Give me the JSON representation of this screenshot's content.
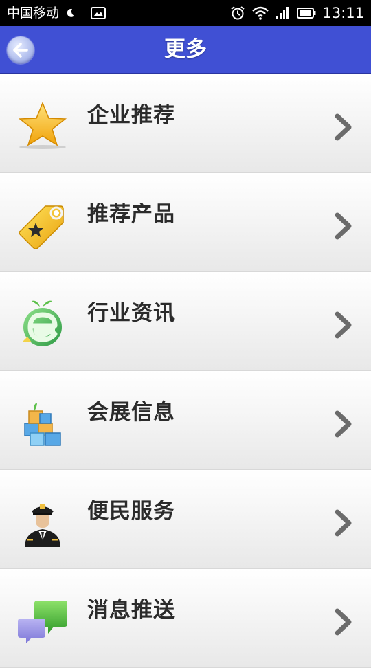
{
  "status_bar": {
    "carrier": "中国移动",
    "time": "13:11",
    "icons": [
      "moon-icon",
      "image-icon",
      "alarm-icon",
      "wifi-icon",
      "signal-icon",
      "battery-icon"
    ]
  },
  "header": {
    "title": "更多",
    "color": "#4050d4",
    "back_icon": "back-arrow-icon"
  },
  "menu": {
    "items": [
      {
        "label": "企业推荐",
        "icon": "star-icon"
      },
      {
        "label": "推荐产品",
        "icon": "tag-icon"
      },
      {
        "label": "行业资讯",
        "icon": "news-e-icon"
      },
      {
        "label": "会展信息",
        "icon": "blocks-icon"
      },
      {
        "label": "便民服务",
        "icon": "pilot-icon"
      },
      {
        "label": "消息推送",
        "icon": "chat-bubbles-icon"
      }
    ],
    "chevron_icon": "chevron-right-icon"
  }
}
